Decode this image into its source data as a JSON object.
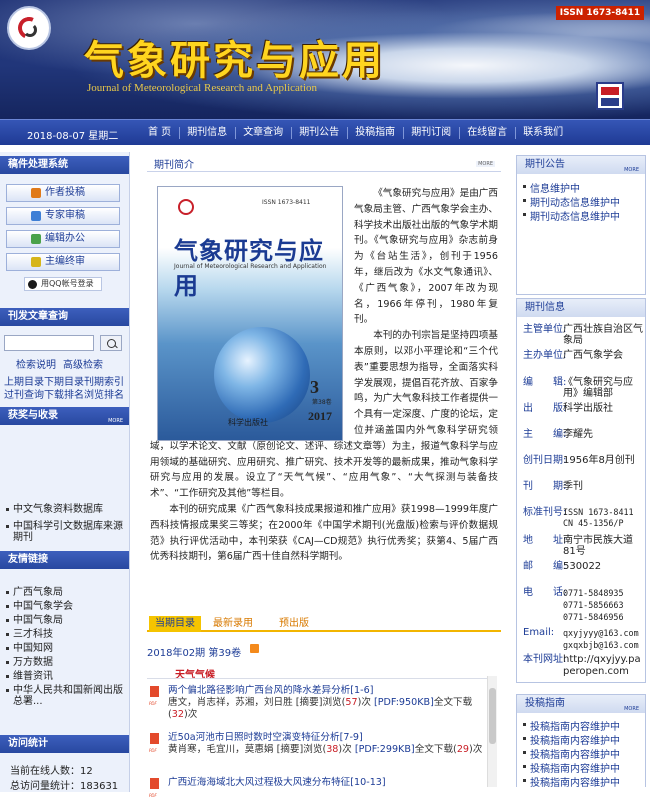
{
  "header": {
    "title_cn": "气象研究与应用",
    "title_en": "Journal of Meteorological Research and Application",
    "issn_badge": "ISSN 1673-8411"
  },
  "nav": {
    "date": "2018-08-07 星期二",
    "items": [
      "首 页",
      "期刊信息",
      "文章查询",
      "期刊公告",
      "投稿指南",
      "期刊订阅",
      "在线留言",
      "联系我们"
    ]
  },
  "left": {
    "manuscript": {
      "title": "稿件处理系统",
      "buttons": [
        "作者投稿",
        "专家审稿",
        "编辑办公",
        "主编终审"
      ],
      "qq_login": "用QQ帐号登录"
    },
    "search": {
      "title": "刊发文章查询",
      "links": [
        "检索说明",
        "高级检索"
      ],
      "line1": "上期目录下期目录刊期索引",
      "line2": "过刊查询下载排名浏览排名"
    },
    "awards": {
      "title": "获奖与收录",
      "more": "MORE",
      "items": [
        "中文气象资料数据库",
        "中国科学引文数据库来源期刊"
      ]
    },
    "links": {
      "title": "友情链接",
      "items": [
        "广西气象局",
        "中国气象学会",
        "中国气象局",
        "三才科技",
        "中国知网",
        "万方数据",
        "维普资讯",
        "中华人民共和国新闻出版总署..."
      ]
    },
    "stats": {
      "title": "访问统计",
      "online": "当前在线人数：12",
      "total": "总访问量统计：183631"
    }
  },
  "intro": {
    "title": "期刊简介",
    "more": "MORE",
    "paragraph1": "《气象研究与应用》是由广西气象局主管、广西气象学会主办、科学技术出版社出版的气象学术期刊。《气象研究与应用》杂志前身为《台站生活》，创刊于1956年，继后改为《水文气象通讯》、《广西气象》，2007年改为现名，1966年停刊，1980年复刊。",
    "paragraph2": "本刊的办刊宗旨是坚持四项基本原则，以邓小平理论和“三个代表”重要思想为指导，全面落实科学发展观，提倡百花齐放、百家争鸣，为广大气象科技工作者提供一个具有一定深度、广度的论坛，定位并涵盖国内外气象科学研究领域，以学术论文、文献（原创论文、述评、综述文章等）为主，报道气象科学与应用领域的基础研究、应用研究、推广研究、技术开发等的最新成果，推动气象科学研究与应用的发展。设立了“天气气候”、“应用气象”、“大气探测与装备技术”、“工作研究及其他”等栏目。",
    "paragraph3": "本刊的研究成果《广西气象科技成果报道和推广应用》获1998—1999年度广西科技情报成果奖三等奖；在2000年《中国学术期刊(光盘版)检索与评价数据规范》执行评优活动中，本刊荣获《CAJ—CD规范》执行优秀奖；获第4、5届广西优秀科技期刊，第6届广西十佳自然科学期刊。",
    "cover": {
      "issn": "ISSN 1673-8411",
      "title": "气象研究与应用",
      "subtitle": "Journal of Meteorological Research and Application",
      "number": "3",
      "volume": "第38卷",
      "year": "2017",
      "press": "科学出版社"
    }
  },
  "tabs": [
    "当期目录",
    "最新录用",
    "预出版"
  ],
  "issue": {
    "line": "2018年02期 第39卷",
    "section": "天气气候",
    "articles": [
      {
        "title": "两个偏北路径影响广西台风的降水差异分析",
        "pages": "[1-6]",
        "authors": "唐文，肖志祥，苏湘，刘日胜",
        "abs": "[摘要]浏览(",
        "abs_n": "57",
        "mid": ")次",
        "pdf": "[PDF:950KB]",
        "dl": "全文下载(",
        "dl_n": "32",
        "end": ")次"
      },
      {
        "title": "近50a河池市日照时数时空演变特征分析",
        "pages": "[7-9]",
        "authors": "黄肖寒，毛宜川，莫惠娟",
        "abs": "[摘要]浏览(",
        "abs_n": "38",
        "mid": ")次",
        "pdf": "[PDF:299KB]",
        "dl": "全文下载(",
        "dl_n": "29",
        "end": ")次"
      },
      {
        "title": "广西近海海域北大风过程极大风速分布特征",
        "pages": "[10-13]",
        "authors": "",
        "abs": "",
        "abs_n": "",
        "mid": "",
        "pdf": "",
        "dl": "",
        "dl_n": "",
        "end": ""
      }
    ]
  },
  "right": {
    "notice": {
      "title": "期刊公告",
      "more": "MORE",
      "items": [
        "信息维护中",
        "期刊动态信息维护中",
        "期刊动态信息维护中"
      ]
    },
    "info": {
      "title": "期刊信息",
      "rows": [
        {
          "label": "主管单位:",
          "value": "广西壮族自治区气象局"
        },
        {
          "label": "主办单位:",
          "value": "广西气象学会"
        },
        {
          "label": "编　　辑:",
          "value": "《气象研究与应用》编辑部"
        },
        {
          "label": "出　　版:",
          "value": "科学出版社"
        },
        {
          "label": "主　　编:",
          "value": "李耀先"
        },
        {
          "label": "创刊日期:",
          "value": "1956年8月创刊"
        },
        {
          "label": "刊　　期:",
          "value": "季刊"
        },
        {
          "label": "标准刊号:",
          "value": "ISSN 1673-8411 CN 45-1356/P"
        },
        {
          "label": "地　　址:",
          "value": "南宁市民族大道81号"
        },
        {
          "label": "邮　　编:",
          "value": "530022"
        },
        {
          "label": "电　　话:",
          "value": "0771-5848935 0771-5856663 0771-5846956"
        },
        {
          "label": "Email:",
          "value": "qxyjyyy@163.com gxqxbjb@163.com"
        },
        {
          "label": "本刊网址:",
          "value": "http://qxyjyy.paperopen.com"
        }
      ]
    },
    "guide": {
      "title": "投稿指南",
      "more": "MORE",
      "items": [
        "投稿指南内容维护中",
        "投稿指南内容维护中",
        "投稿指南内容维护中",
        "投稿指南内容维护中",
        "投稿指南内容维护中"
      ]
    }
  }
}
